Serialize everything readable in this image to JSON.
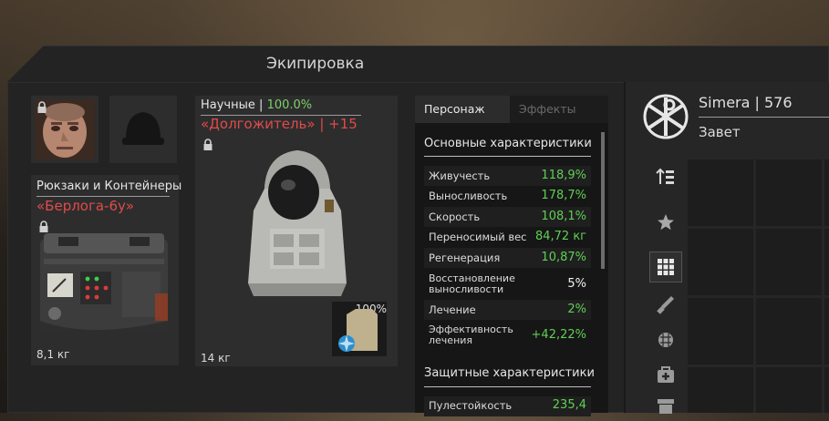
{
  "window": {
    "title": "Экипировка"
  },
  "slots": {
    "backpack": {
      "category": "Рюкзаки и Контейнеры",
      "name": "«Берлога-6у»",
      "weight": "8,1 кг"
    },
    "armor": {
      "category": "Научные",
      "separator": "|",
      "quality": "100.0%",
      "name": "«Долгожитель» | +15",
      "weight": "14 кг",
      "plate_durability": "100%"
    }
  },
  "tabs": [
    {
      "label": "Персонаж",
      "active": true
    },
    {
      "label": "Эффекты",
      "active": false
    }
  ],
  "sections": {
    "main": "Основные характеристики",
    "protective": "Защитные характеристики"
  },
  "stats": [
    {
      "label": "Живучесть",
      "value": "118,9%"
    },
    {
      "label": "Выносливость",
      "value": "178,7%"
    },
    {
      "label": "Скорость",
      "value": "108,1%"
    },
    {
      "label": "Переносимый вес",
      "value": "84,72 кг"
    },
    {
      "label": "Регенерация",
      "value": "10,87%"
    },
    {
      "label": "Восстановление выносливости",
      "value": "5%"
    },
    {
      "label": "Лечение",
      "value": "2%"
    },
    {
      "label": "Эффективность лечения",
      "value": "+42,22%"
    }
  ],
  "protective_stats": [
    {
      "label": "Пулестойкость",
      "value": "235,4"
    }
  ],
  "player": {
    "name": "Simera | 576",
    "faction": "Завет"
  },
  "colors": {
    "positive": "#5fcf55",
    "rarity": "#7fd06a",
    "item_name": "#e04b4b"
  },
  "icons": [
    "lock-icon",
    "faction-emblem-icon",
    "sort-icon",
    "star-icon",
    "grid-icon",
    "knife-icon",
    "grenade-icon",
    "medkit-icon",
    "archive-icon"
  ]
}
